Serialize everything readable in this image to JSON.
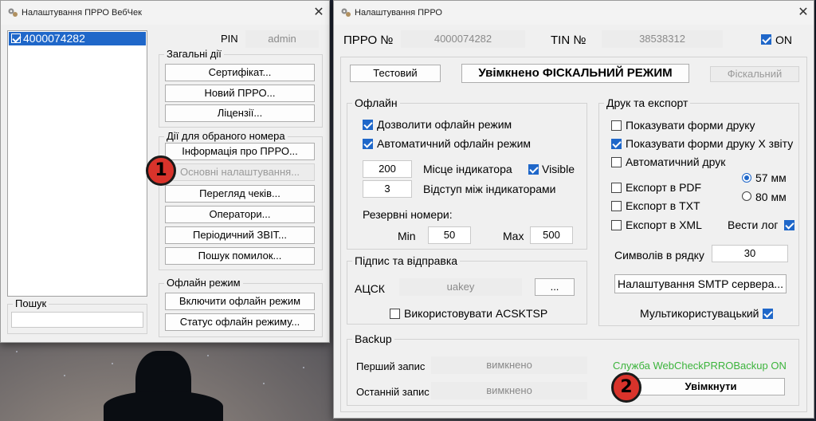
{
  "left_window": {
    "title": "Налаштування ПРРО ВебЧек",
    "list_items": [
      "4000074282"
    ],
    "pin_label": "PIN",
    "pin_value": "admin",
    "search_label": "Пошук",
    "search_value": "",
    "group_general": "Загальні дії",
    "btn_certificate": "Сертифікат...",
    "btn_new_prro": "Новий ПРРО...",
    "btn_licenses": "Ліцензії...",
    "group_selected": "Дії для обраного номера",
    "btn_info": "Інформація про ПРРО...",
    "btn_main_settings": "Основні налаштування...",
    "btn_checks": "Перегляд чеків...",
    "btn_operators": "Оператори...",
    "btn_periodic": "Періодичний ЗВІТ...",
    "btn_errors": "Пошук помилок...",
    "group_offline": "Офлайн режим",
    "btn_offline_on": "Включити офлайн режим",
    "btn_offline_status": "Статус офлайн режиму..."
  },
  "right_window": {
    "title": "Налаштування ПРРО",
    "prro_label": "ПРРО №",
    "prro_value": "4000074282",
    "tin_label": "TIN №",
    "tin_value": "38538312",
    "on_label": "ON",
    "on_checked": true,
    "btn_test": "Тестовий",
    "fiscal_mode_label": "Увімкнено ФІСКАЛЬНИЙ РЕЖИМ",
    "btn_fiscal": "Фіскальний",
    "offline": {
      "title": "Офлайн",
      "allow_label": "Дозволити офлайн режим",
      "allow_checked": true,
      "auto_label": "Автоматичний офлайн режим",
      "auto_checked": true,
      "indicator_value": "200",
      "indicator_label": "Місце індикатора",
      "visible_label": "Visible",
      "visible_checked": true,
      "gap_value": "3",
      "gap_label": "Відступ між індикаторами",
      "reserve_label": "Резервні номери:",
      "min_label": "Min",
      "min_value": "50",
      "max_label": "Max",
      "max_value": "500"
    },
    "signing": {
      "title": "Підпис та відправка",
      "acsk_label": "АЦСК",
      "acsk_value": "uakey",
      "browse_label": "...",
      "acsktsp_label": "Використовувати ACSKTSP",
      "acsktsp_checked": false
    },
    "print": {
      "title": "Друк та експорт",
      "show_forms_label": "Показувати форми друку",
      "show_forms_checked": false,
      "show_x_label": "Показувати форми друку Х звіту",
      "show_x_checked": true,
      "auto_print_label": "Автоматичний друк",
      "auto_print_checked": false,
      "pdf_label": "Експорт в PDF",
      "pdf_checked": false,
      "txt_label": "Експорт в TXT",
      "txt_checked": false,
      "xml_label": "Експорт в XML",
      "xml_checked": false,
      "width_57_label": "57 мм",
      "width_80_label": "80 мм",
      "width_selected": "57 мм",
      "log_label": "Вести лог",
      "log_checked": true,
      "symbols_label": "Символів в рядку",
      "symbols_value": "30",
      "smtp_button": "Налаштування SMTP сервера...",
      "multiuser_label": "Мультикористувацький",
      "multiuser_checked": true
    },
    "backup": {
      "title": "Backup",
      "first_label": "Перший запис",
      "first_value": "вимкнено",
      "last_label": "Останній запис",
      "last_value": "вимкнено",
      "service_status": "Служба WebCheckPRROBackup ON",
      "service_color": "#3cb43c",
      "enable_button": "Увімкнути"
    }
  },
  "annotations": [
    "1",
    "2"
  ],
  "colors": {
    "accent": "#1f67c9",
    "badge": "#d9332b",
    "selection": "#1f67c9"
  }
}
